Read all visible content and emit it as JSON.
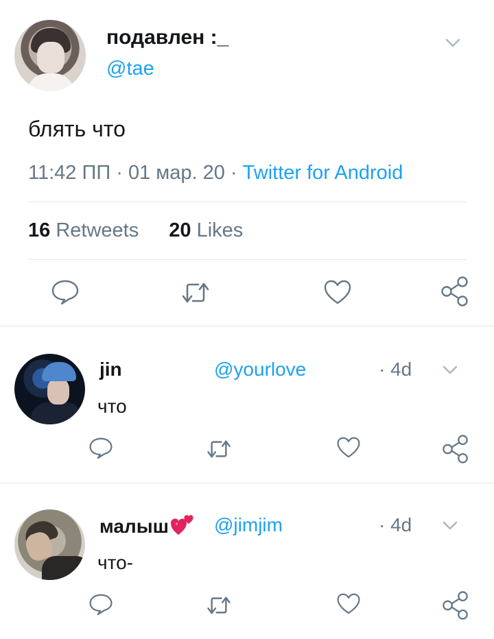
{
  "main_tweet": {
    "display_name": "подавлен :_",
    "handle": "@tae",
    "text": "блять что",
    "time": "11:42 ПП",
    "date": "01 мар. 20",
    "separator": "·",
    "source": "Twitter for Android",
    "retweets_count": "16",
    "retweets_label": "Retweets",
    "likes_count": "20",
    "likes_label": "Likes"
  },
  "replies": [
    {
      "display_name": "jin",
      "handle": "@yourlove",
      "time": "· 4d",
      "text": "что"
    },
    {
      "display_name": "малыш",
      "handle": "@jimjim",
      "time": "· 4d",
      "text": "что-"
    }
  ],
  "icons": {
    "reply": "speech-bubble-icon",
    "retweet": "retweet-icon",
    "like": "heart-icon",
    "share": "share-icon",
    "menu": "chevron-down-icon",
    "name_emoji": "two-hearts-icon"
  },
  "colors": {
    "accent": "#1da1f2",
    "text": "#14171a",
    "secondary_text": "#657786",
    "icon": "#657786",
    "divider": "#e1e8ed",
    "emoji": "#e0245e"
  }
}
